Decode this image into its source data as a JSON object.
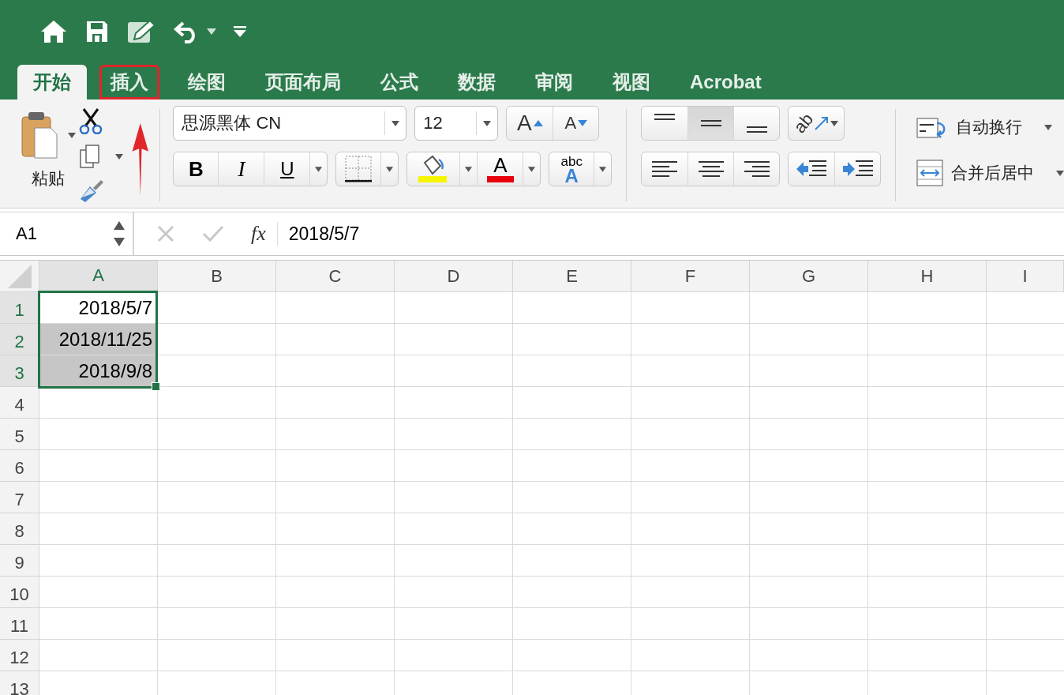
{
  "tabs": [
    {
      "label": "开始",
      "selected": true,
      "highlighted": false
    },
    {
      "label": "插入",
      "selected": false,
      "highlighted": true
    },
    {
      "label": "绘图",
      "selected": false,
      "highlighted": false
    },
    {
      "label": "页面布局",
      "selected": false,
      "highlighted": false
    },
    {
      "label": "公式",
      "selected": false,
      "highlighted": false
    },
    {
      "label": "数据",
      "selected": false,
      "highlighted": false
    },
    {
      "label": "审阅",
      "selected": false,
      "highlighted": false
    },
    {
      "label": "视图",
      "selected": false,
      "highlighted": false
    },
    {
      "label": "Acrobat",
      "selected": false,
      "highlighted": false
    }
  ],
  "ribbon": {
    "paste_label": "粘贴",
    "font_name": "思源黑体 CN",
    "font_size": "12",
    "grow_font": "A",
    "shrink_font": "A",
    "bold": "B",
    "italic": "I",
    "underline": "U",
    "font_color": "A",
    "text_style_small": "abc",
    "text_style_large": "A",
    "orientation": "ab",
    "vertical_align": [
      {
        "kind": "top",
        "selected": false
      },
      {
        "kind": "middle",
        "selected": true
      },
      {
        "kind": "bottom",
        "selected": false
      }
    ],
    "wrap_text": "自动换行",
    "merge_center": "合并后居中"
  },
  "formula_bar": {
    "name_box": "A1",
    "fx": "fx",
    "formula": "2018/5/7"
  },
  "sheet": {
    "columns": [
      {
        "label": "A",
        "selected": true
      },
      {
        "label": "B",
        "selected": false
      },
      {
        "label": "C",
        "selected": false
      },
      {
        "label": "D",
        "selected": false
      },
      {
        "label": "E",
        "selected": false
      },
      {
        "label": "F",
        "selected": false
      },
      {
        "label": "G",
        "selected": false
      },
      {
        "label": "H",
        "selected": false
      },
      {
        "label": "I",
        "selected": false
      }
    ],
    "rows": [
      {
        "label": "1",
        "selected": true,
        "cells": [
          {
            "text": "2018/5/7",
            "selected": true,
            "active": true
          }
        ]
      },
      {
        "label": "2",
        "selected": true,
        "cells": [
          {
            "text": "2018/11/25",
            "selected": true,
            "active": false
          }
        ]
      },
      {
        "label": "3",
        "selected": true,
        "cells": [
          {
            "text": "2018/9/8",
            "selected": true,
            "active": false
          }
        ]
      },
      {
        "label": "4",
        "selected": false
      },
      {
        "label": "5",
        "selected": false
      },
      {
        "label": "6",
        "selected": false
      },
      {
        "label": "7",
        "selected": false
      },
      {
        "label": "8",
        "selected": false
      },
      {
        "label": "9",
        "selected": false
      },
      {
        "label": "10",
        "selected": false
      },
      {
        "label": "11",
        "selected": false
      },
      {
        "label": "12",
        "selected": false
      },
      {
        "label": "13",
        "selected": false
      }
    ]
  }
}
